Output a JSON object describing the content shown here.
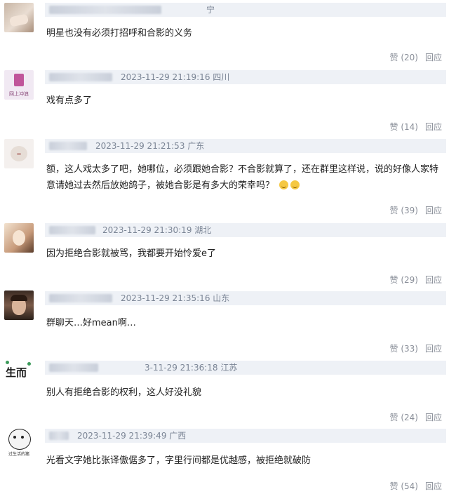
{
  "comments": [
    {
      "meta": "宁",
      "text": "明星也没有必须打招呼和合影的义务",
      "like": "赞 (20)",
      "reply": "回应"
    },
    {
      "meta": "2023-11-29 21:19:16 四川",
      "text": "戏有点多了",
      "like": "赞 (14)",
      "reply": "回应"
    },
    {
      "meta": "2023-11-29 21:21:53 广东",
      "text": "额，这人戏太多了吧，她哪位，必须跟她合影？不合影就算了，还在群里这样说，说的好像人家特意请她过去然后放她鸽子，被她合影是有多大的荣幸吗？",
      "like": "赞 (39)",
      "reply": "回应"
    },
    {
      "meta": "2023-11-29 21:30:19 湖北",
      "text": "因为拒绝合影就被骂，我都要开始怜爱e了",
      "like": "赞 (29)",
      "reply": "回应"
    },
    {
      "meta": "2023-11-29 21:35:16 山东",
      "text": "群聊天…好mean啊…",
      "like": "赞 (33)",
      "reply": "回应"
    },
    {
      "meta": "3-11-29 21:36:18 江苏",
      "text": "别人有拒绝合影的权利，这人好没礼貌",
      "like": "赞 (24)",
      "reply": "回应"
    },
    {
      "meta": "2023-11-29 21:39:49 广西",
      "text": "光看文字她比张译傲倨多了，字里行间都是优越感，被拒绝就破防",
      "like": "赞 (54)",
      "reply": "回应"
    }
  ],
  "avatar_labels": {
    "a2": "网上冲浪",
    "a6": "生而",
    "a7": "过生活的猪"
  },
  "colors": {
    "meta_bar": "#eef1f6",
    "action_text": "#8a8f99"
  }
}
